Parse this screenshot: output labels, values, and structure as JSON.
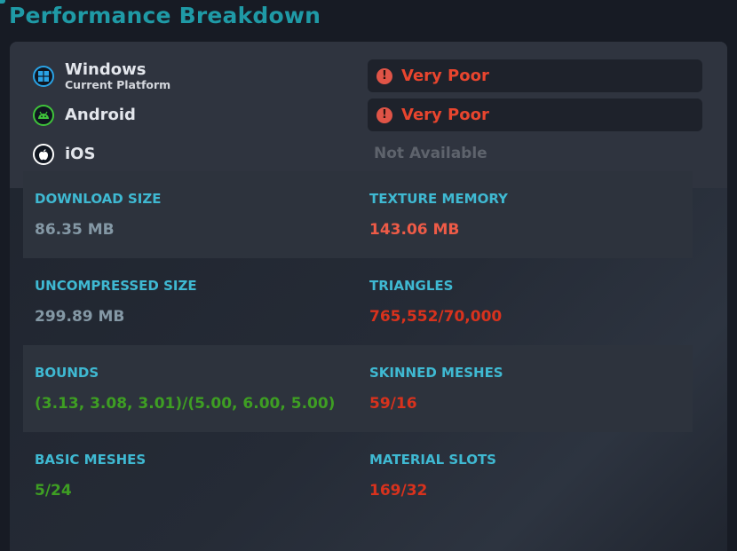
{
  "title": "Performance Breakdown",
  "platforms": [
    {
      "name": "Windows",
      "subtitle": "Current Platform",
      "icon": "windows-icon",
      "rating": "Very Poor"
    },
    {
      "name": "Android",
      "subtitle": "",
      "icon": "android-icon",
      "rating": "Very Poor"
    },
    {
      "name": "iOS",
      "subtitle": "",
      "icon": "apple-icon",
      "rating": "Not Available"
    }
  ],
  "stats": {
    "download_size": {
      "label": "DOWNLOAD SIZE",
      "value": "86.35 MB"
    },
    "texture_memory": {
      "label": "TEXTURE MEMORY",
      "value": "143.06 MB"
    },
    "uncompressed_size": {
      "label": "UNCOMPRESSED SIZE",
      "value": "299.89 MB"
    },
    "triangles": {
      "label": "TRIANGLES",
      "value": "765,552/70,000"
    },
    "bounds": {
      "label": "BOUNDS",
      "value": "(3.13, 3.08, 3.01)/(5.00, 6.00, 5.00)"
    },
    "skinned_meshes": {
      "label": "SKINNED MESHES",
      "value": "59/16"
    },
    "basic_meshes": {
      "label": "BASIC MESHES",
      "value": "5/24"
    },
    "material_slots": {
      "label": "MATERIAL SLOTS",
      "value": "169/32"
    }
  },
  "colors": {
    "title": "#1f9aa6",
    "label": "#3fb9d2",
    "neutral_value": "#8498a5",
    "poor": "#d8321d",
    "good": "#3e9e23"
  }
}
